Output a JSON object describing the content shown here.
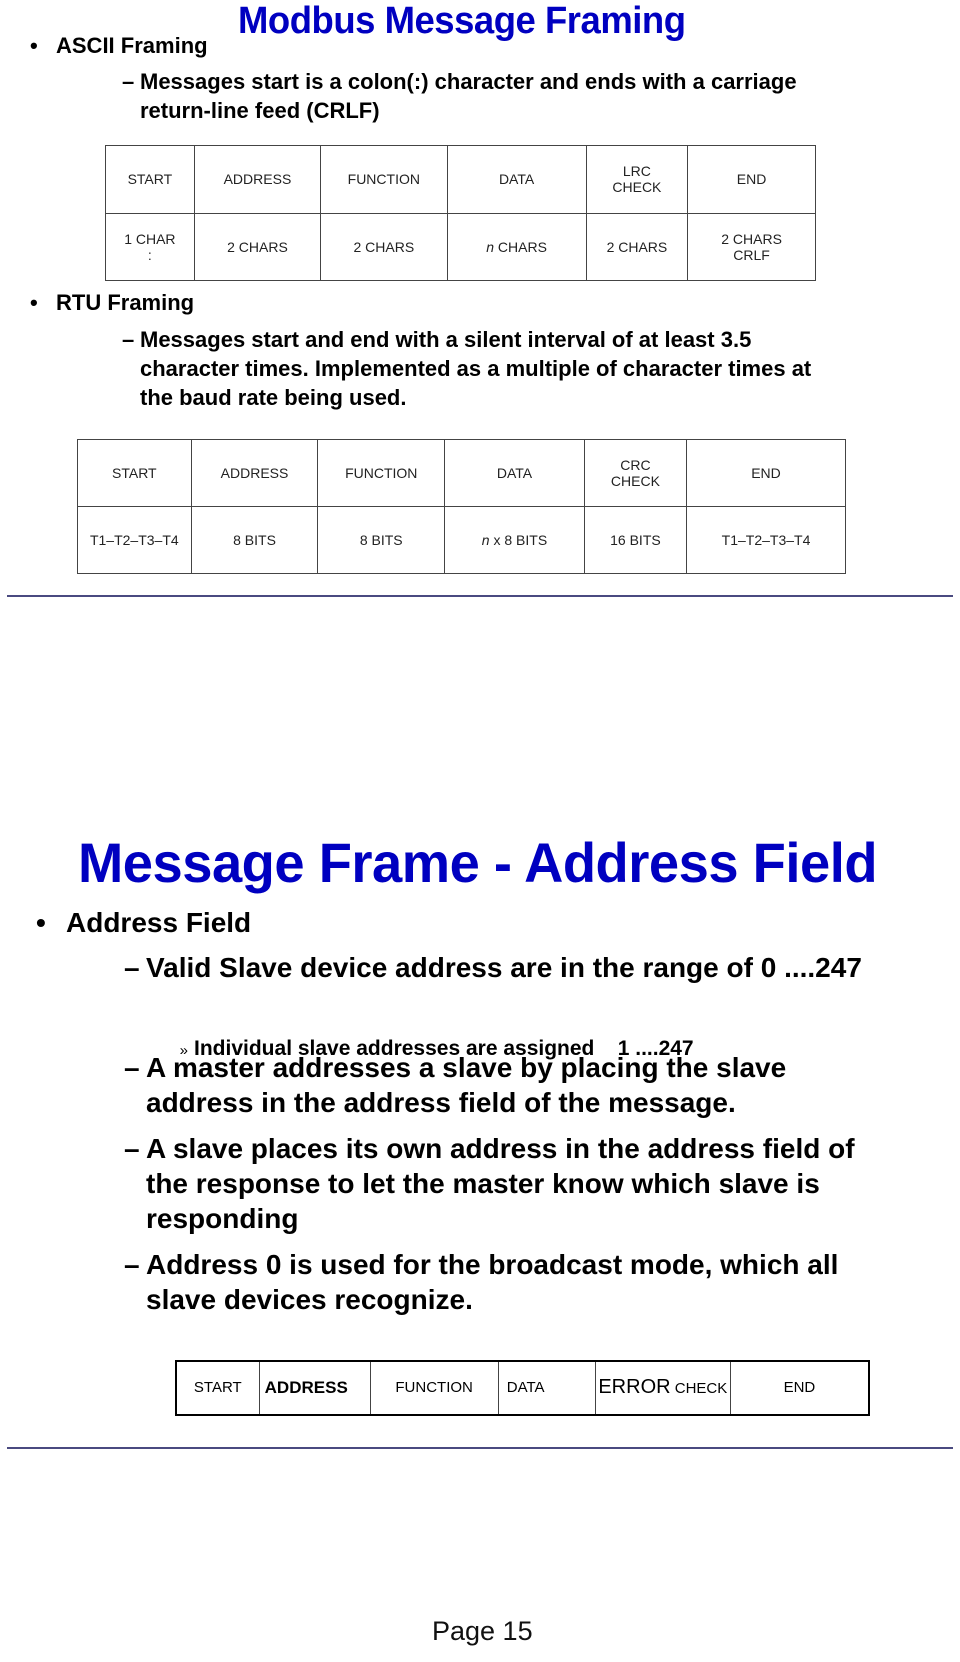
{
  "slide1": {
    "title": "Modbus Message Framing",
    "bullet_ascii": "ASCII Framing",
    "ascii_desc_line1": "Messages start is a colon(:) character and ends with a carriage",
    "ascii_desc_line2": "return-line feed (CRLF)",
    "ascii_table": {
      "headers": [
        "START",
        "ADDRESS",
        "FUNCTION",
        "DATA",
        "LRC CHECK",
        "END"
      ],
      "values": [
        "1 CHAR :",
        "2 CHARS",
        "2 CHARS",
        "n CHARS",
        "2 CHARS",
        "2 CHARS CRLF"
      ]
    },
    "bullet_rtu": "RTU Framing",
    "rtu_desc_line1": "Messages start and end with a silent interval of at least 3.5",
    "rtu_desc_line2": "character times.  Implemented as a multiple of character times at",
    "rtu_desc_line3": "the baud rate being used.",
    "rtu_table": {
      "headers": [
        "START",
        "ADDRESS",
        "FUNCTION",
        "DATA",
        "CRC CHECK",
        "END"
      ],
      "values": [
        "T1–T2–T3–T4",
        "8 BITS",
        "8 BITS",
        "n x 8 BITS",
        "16 BITS",
        "T1–T2–T3–T4"
      ]
    }
  },
  "slide2": {
    "title": "Message Frame - Address Field",
    "bullet": "Address Field",
    "items": [
      {
        "lines": [
          "Valid Slave device address are in the range of  0 ....247"
        ]
      },
      {
        "lines": [
          "A master addresses a slave by placing the slave",
          "address in the address field of the message."
        ]
      },
      {
        "lines": [
          "A slave places its own address in the address field of",
          "the response to let the master know which slave is",
          "responding"
        ]
      },
      {
        "lines": [
          "Address 0 is used for the broadcast mode, which all",
          "slave devices recognize."
        ]
      }
    ],
    "subitem": "Individual slave addresses are assigned    1 ....247",
    "frame_table": {
      "cells": [
        "START",
        "ADDRESS",
        "FUNCTION",
        "DATA",
        "ERROR",
        "CHECK",
        "END"
      ]
    }
  },
  "footer": {
    "page_label": "Page 15"
  },
  "glyphs": {
    "bullet": "•",
    "dash": "–",
    "chevron": "»"
  }
}
